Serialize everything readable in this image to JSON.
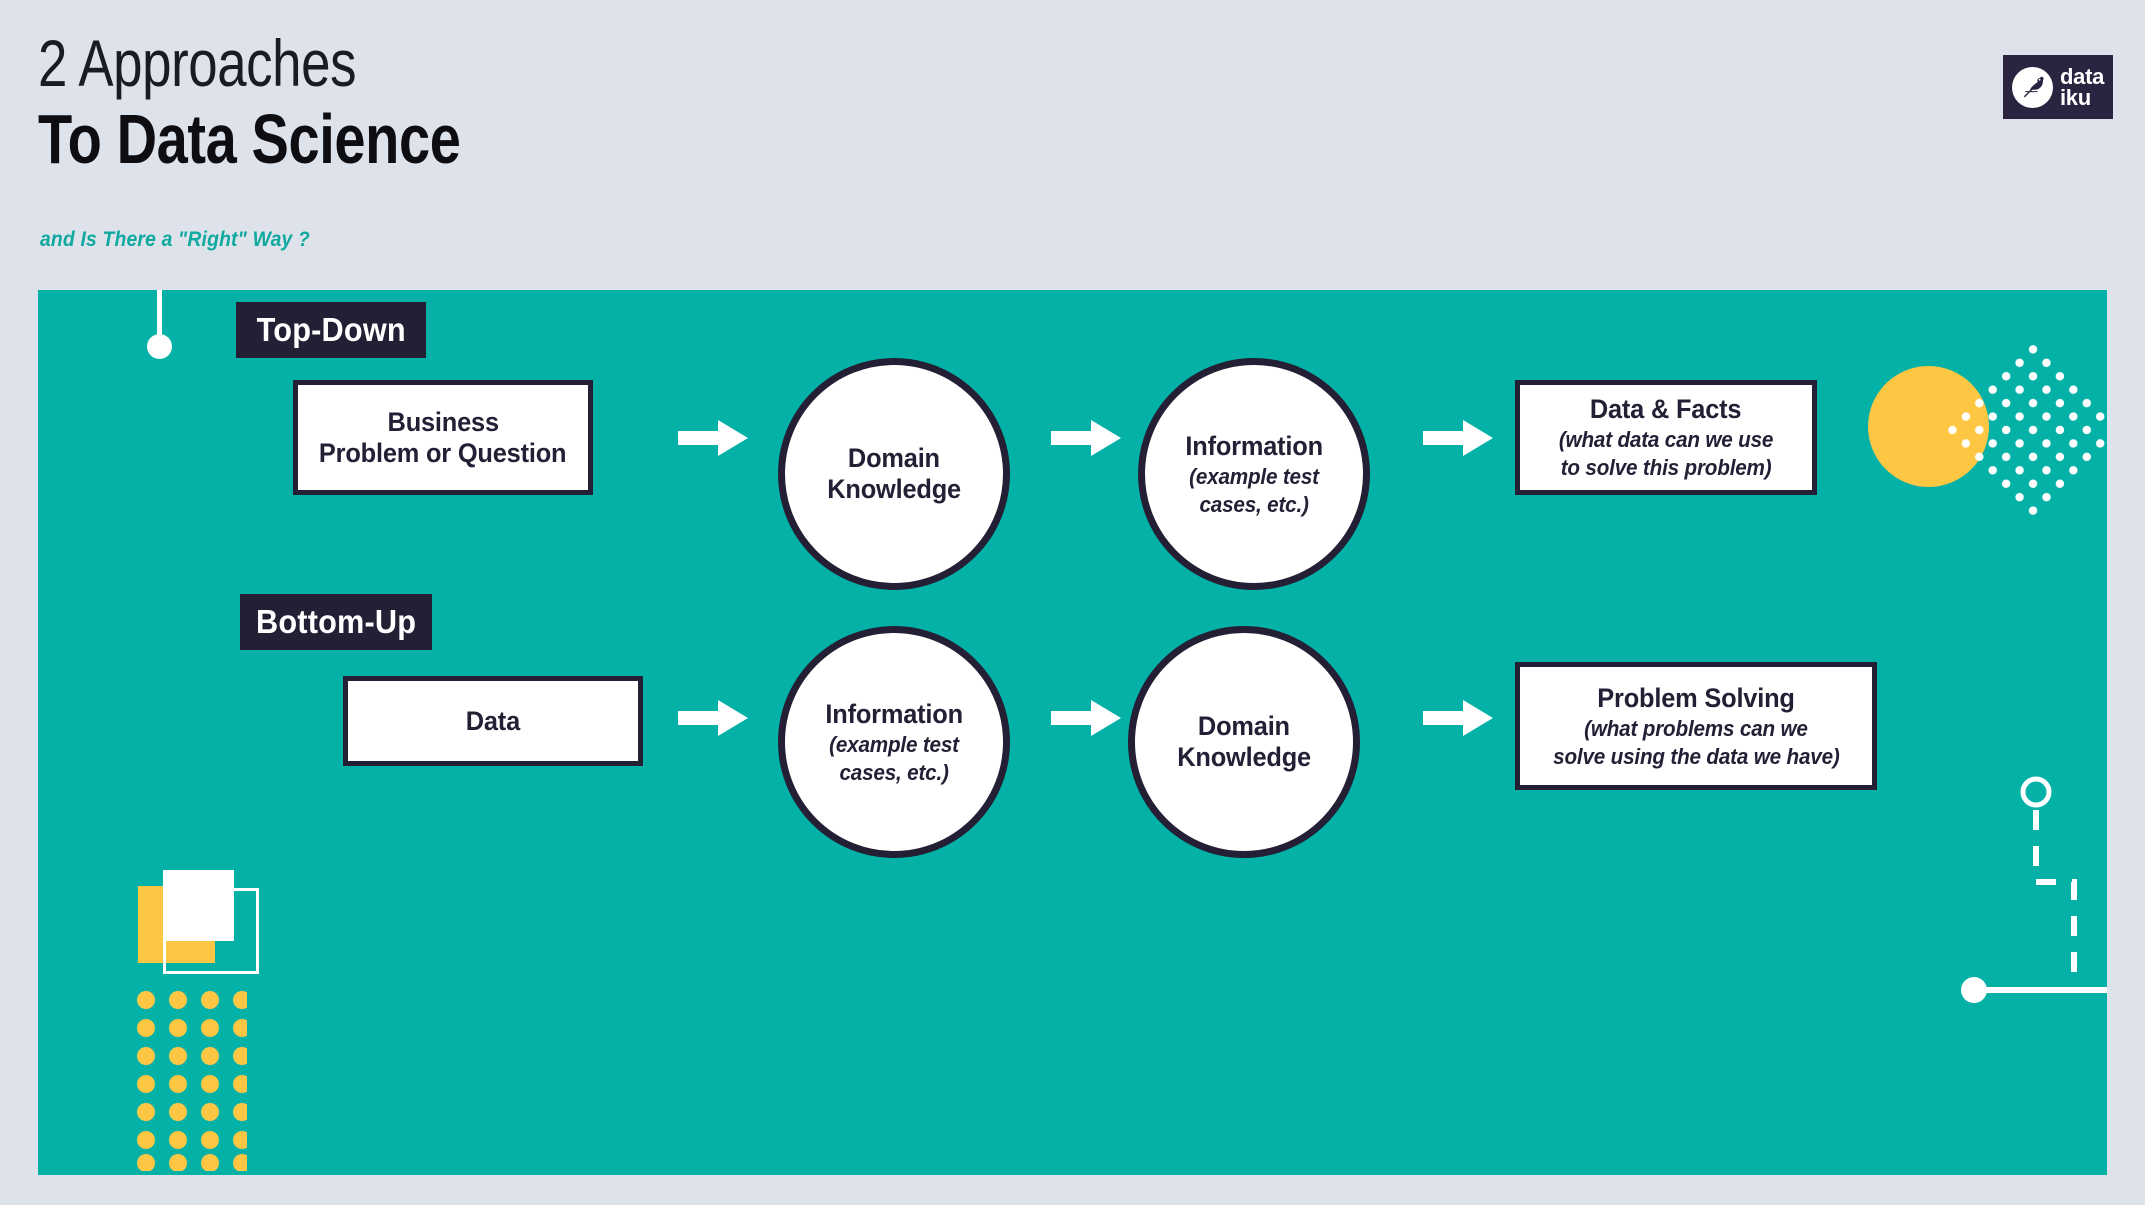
{
  "header": {
    "title_line1": "2 Approaches",
    "title_line2": "To Data Science",
    "subtitle": "and Is There a \"Right\" Way ?"
  },
  "logo": {
    "line1": "data",
    "line2": "iku",
    "icon": "dataiku-bird-icon"
  },
  "colors": {
    "background": "#dee3eb",
    "panel_teal": "#04b1a7",
    "navy": "#241f35",
    "yellow": "#fdc744",
    "white": "#ffffff",
    "subtitle_teal": "#10a99f"
  },
  "flows": [
    {
      "id": "top-down",
      "badge": "Top-Down",
      "steps": [
        {
          "shape": "box",
          "title": "Business\nProblem or Question",
          "title_line1": "Business",
          "title_line2": "Problem or Question",
          "subtitle": ""
        },
        {
          "shape": "circle",
          "title_line1": "Domain",
          "title_line2": "Knowledge",
          "subtitle": ""
        },
        {
          "shape": "circle",
          "title_line1": "Information",
          "title_line2": "",
          "subtitle": "(example test\ncases, etc.)",
          "subtitle_line1": "(example test",
          "subtitle_line2": "cases, etc.)"
        },
        {
          "shape": "box",
          "title_line1": "Data & Facts",
          "title_line2": "",
          "subtitle_line1": "(what data can we use",
          "subtitle_line2": "to solve this problem)"
        }
      ],
      "arrows": [
        "arrow-right",
        "arrow-right",
        "arrow-right"
      ]
    },
    {
      "id": "bottom-up",
      "badge": "Bottom-Up",
      "steps": [
        {
          "shape": "box",
          "title_line1": "Data",
          "title_line2": "",
          "subtitle": ""
        },
        {
          "shape": "circle",
          "title_line1": "Information",
          "title_line2": "",
          "subtitle_line1": "(example test",
          "subtitle_line2": "cases, etc.)"
        },
        {
          "shape": "circle",
          "title_line1": "Domain",
          "title_line2": "Knowledge",
          "subtitle": ""
        },
        {
          "shape": "box",
          "title_line1": "Problem Solving",
          "title_line2": "",
          "subtitle_line1": "(what problems can we",
          "subtitle_line2": "solve using the data we have)"
        }
      ],
      "arrows": [
        "arrow-right",
        "arrow-right",
        "arrow-right"
      ]
    }
  ],
  "decorations": [
    {
      "name": "line-with-dot-top-left"
    },
    {
      "name": "yellow-circle-with-dot-diamond"
    },
    {
      "name": "squares-and-dot-grid-bottom-left"
    },
    {
      "name": "dashed-path-with-circles-right"
    }
  ]
}
